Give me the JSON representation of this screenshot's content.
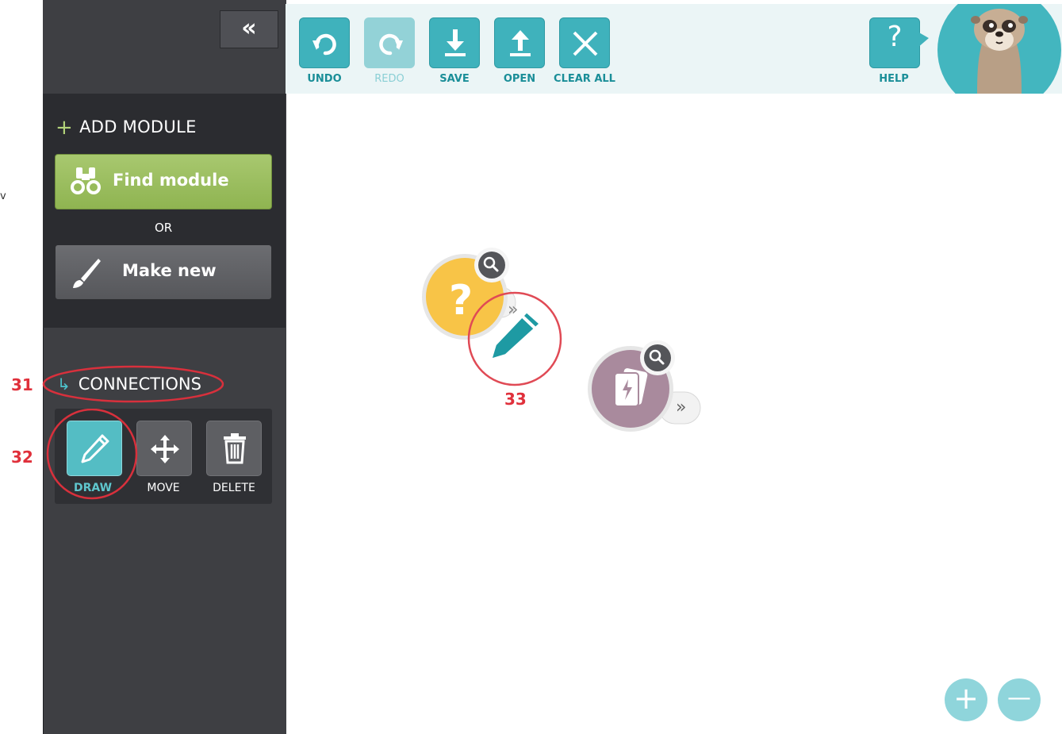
{
  "gutter": {
    "cut_text": "v"
  },
  "sidebar": {
    "collapse_label": "«",
    "add_module_title": "ADD MODULE",
    "add_plus": "+",
    "find_module_label": "Find module",
    "or_label": "OR",
    "make_new_label": "Make new",
    "connections_title": "CONNECTIONS",
    "connections_arrow": "↳",
    "tools": [
      {
        "label": "DRAW",
        "active": true,
        "icon": "pencil-icon"
      },
      {
        "label": "MOVE",
        "active": false,
        "icon": "move-arrows-icon"
      },
      {
        "label": "DELETE",
        "active": false,
        "icon": "trash-icon"
      }
    ]
  },
  "toolbar": {
    "buttons": [
      {
        "label": "UNDO",
        "icon": "undo-icon",
        "enabled": true
      },
      {
        "label": "REDO",
        "icon": "redo-icon",
        "enabled": false
      },
      {
        "label": "SAVE",
        "icon": "download-icon",
        "enabled": true
      },
      {
        "label": "OPEN",
        "icon": "upload-icon",
        "enabled": true
      },
      {
        "label": "CLEAR ALL",
        "icon": "close-icon",
        "enabled": true
      }
    ],
    "help_label": "HELP",
    "help_symbol": "?"
  },
  "canvas": {
    "modules": [
      {
        "type": "question",
        "symbol": "?",
        "color": "#f8c447",
        "icon": "question-module-icon"
      },
      {
        "type": "card",
        "color": "#a98a9d",
        "icon": "lightning-card-icon"
      }
    ],
    "expand_symbol": "»",
    "zoom_in": "+",
    "zoom_out": "—"
  },
  "annotations": {
    "a31": "31",
    "a32": "32",
    "a33": "33"
  },
  "colors": {
    "accent": "#3fb2bc",
    "sidebar": "#3e3f43",
    "green": "#a8c86f",
    "annotation_red": "#e0303b"
  }
}
